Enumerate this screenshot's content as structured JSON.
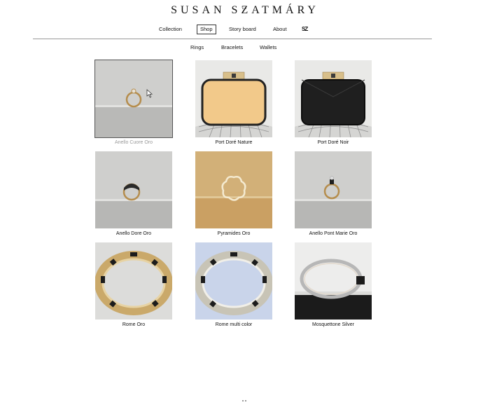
{
  "brand": {
    "name": "SUSAN SZATMÁRY"
  },
  "nav": {
    "items": [
      {
        "label": "Collection"
      },
      {
        "label": "Shop"
      },
      {
        "label": "Story board"
      },
      {
        "label": "About"
      }
    ],
    "logo_icon": "SZ"
  },
  "subnav": {
    "items": [
      {
        "label": "Rings"
      },
      {
        "label": "Bracelets"
      },
      {
        "label": "Wallets"
      }
    ]
  },
  "products": [
    {
      "name": "Anello Cuore Oro"
    },
    {
      "name": "Port Doré Nature"
    },
    {
      "name": "Port Doré Noir"
    },
    {
      "name": "Anello Dore Oro"
    },
    {
      "name": "Pyramides Oro"
    },
    {
      "name": "Anello Pont Marie Oro"
    },
    {
      "name": "Rome Oro"
    },
    {
      "name": "Rome multi color"
    },
    {
      "name": "Mosquettone Silver"
    }
  ],
  "colors": {
    "accent_gold": "#c8a24a",
    "wall_gray": "#d6d6d4",
    "clutch_nature": "#f2c98a",
    "clutch_noir": "#1b1b1b"
  }
}
